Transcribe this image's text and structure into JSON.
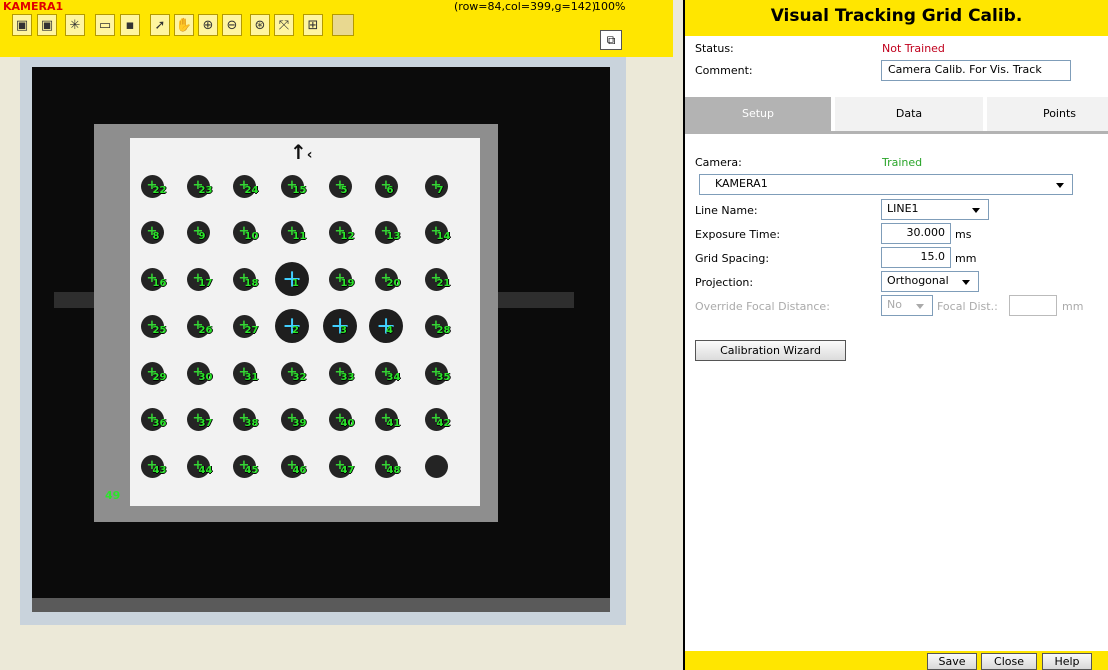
{
  "camera_panel": {
    "name": "KAMERA1",
    "pixel_readout": "(row=84,col=399,g=142)",
    "zoom": "100%",
    "toolbar_icons": [
      "live-icon",
      "snapshot-icon",
      "burst-icon",
      "open-folder-icon",
      "save-icon",
      "pointer-icon",
      "pan-hand-icon",
      "zoom-in-icon",
      "zoom-out-icon",
      "zoom-fit-icon",
      "expand-icon",
      "overlay-grid-icon",
      "blank-icon"
    ],
    "dot_labels": {
      "row1": [
        "22",
        "23",
        "24",
        "15",
        "5",
        "6",
        "7"
      ],
      "row2": [
        "8",
        "9",
        "10",
        "11",
        "12",
        "13",
        "14"
      ],
      "row3": [
        "16",
        "17",
        "18",
        "1",
        "19",
        "20",
        "21"
      ],
      "row4": [
        "25",
        "26",
        "27",
        "2",
        "3",
        "4",
        "28"
      ],
      "row5": [
        "29",
        "30",
        "31",
        "32",
        "33",
        "34",
        "35"
      ],
      "row6": [
        "36",
        "37",
        "38",
        "39",
        "40",
        "41",
        "42"
      ],
      "row7": [
        "43",
        "44",
        "45",
        "46",
        "47",
        "48",
        ""
      ]
    },
    "corner_label": "49"
  },
  "tool_panel": {
    "title": "Visual Tracking Grid Calib.",
    "status_label": "Status:",
    "status_value": "Not Trained",
    "comment_label": "Comment:",
    "comment_value": "Camera Calib. For Vis. Track",
    "tabs": [
      "Setup",
      "Data",
      "Points"
    ],
    "camera_label": "Camera:",
    "camera_status": "Trained",
    "camera_value": "KAMERA1",
    "line_name_label": "Line Name:",
    "line_name_value": "LINE1",
    "exposure_label": "Exposure Time:",
    "exposure_value": "30.000",
    "exposure_unit": "ms",
    "spacing_label": "Grid Spacing:",
    "spacing_value": "15.0",
    "spacing_unit": "mm",
    "projection_label": "Projection:",
    "projection_value": "Orthogonal",
    "override_label": "Override Focal Distance:",
    "override_value": "No",
    "focal_label": "Focal Dist.:",
    "focal_value": "",
    "focal_unit": "mm",
    "wizard_button": "Calibration Wizard",
    "footer_buttons": [
      "Save",
      "Close",
      "Help"
    ]
  }
}
